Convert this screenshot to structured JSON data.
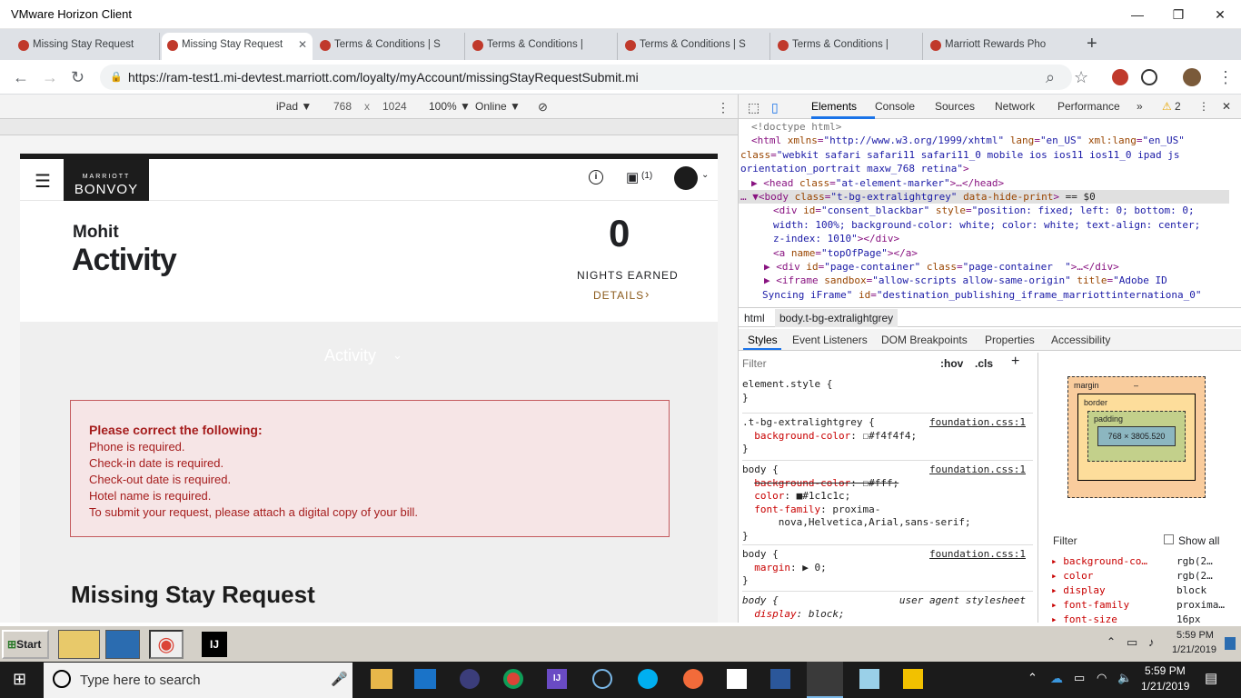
{
  "window": {
    "title": "VMware Horizon Client",
    "controls": [
      "—",
      "❐",
      "✕"
    ]
  },
  "browser": {
    "tabs": [
      {
        "label": "Missing Stay Request",
        "active": false
      },
      {
        "label": "Missing Stay Request",
        "active": true
      },
      {
        "label": "Terms & Conditions | S",
        "active": false
      },
      {
        "label": "Terms & Conditions |",
        "active": false
      },
      {
        "label": "Terms & Conditions | S",
        "active": false
      },
      {
        "label": "Terms & Conditions |",
        "active": false
      },
      {
        "label": "Marriott Rewards Pho",
        "active": false
      }
    ],
    "url": "https://ram-test1.mi-devtest.marriott.com/loyalty/myAccount/missingStayRequestSubmit.mi"
  },
  "device_toolbar": {
    "device": "iPad ▼",
    "width": "768",
    "x": "x",
    "height": "1024",
    "zoom": "100% ▼",
    "network": "Online ▼"
  },
  "site": {
    "logo_top": "MARRIOTT",
    "logo_bottom": "BONVOY",
    "points_badge": "(1)",
    "user_name": "Mohit",
    "heading": "Activity",
    "nights_value": "0",
    "nights_label": "NIGHTS EARNED",
    "details_link": "DETAILS",
    "activity_dropdown": "Activity",
    "errors": {
      "title": "Please correct the following:",
      "items": [
        "Phone is required.",
        "Check-in date is required.",
        "Check-out date is required.",
        "Hotel name is required.",
        "To submit your request, please attach a digital copy of your bill."
      ]
    },
    "form_title": "Missing Stay Request"
  },
  "devtools": {
    "tabs": [
      "Elements",
      "Console",
      "Sources",
      "Network",
      "Performance"
    ],
    "warnings": "2",
    "breadcrumbs": [
      "html",
      "body.t-bg-extralightgrey"
    ],
    "sub_tabs": [
      "Styles",
      "Event Listeners",
      "DOM Breakpoints",
      "Properties",
      "Accessibility"
    ],
    "filter_placeholder": "Filter",
    "hov": ":hov",
    "cls": ".cls",
    "box_model": {
      "margin": "margin",
      "border": "border",
      "padding": "padding",
      "content": "768 × 3805.520",
      "dash": "–"
    },
    "computed_filter": "Filter",
    "show_all": "Show all",
    "computed": [
      {
        "prop": "background-co…",
        "val": "rgb(2…"
      },
      {
        "prop": "color",
        "val": "rgb(2…"
      },
      {
        "prop": "display",
        "val": "block"
      },
      {
        "prop": "font-family",
        "val": "proxima…"
      },
      {
        "prop": "font-size",
        "val": "16px"
      }
    ]
  },
  "vmware_taskbar": {
    "start": "Start",
    "time": "5:59 PM",
    "date": "1/21/2019"
  },
  "windows_taskbar": {
    "search_placeholder": "Type here to search",
    "time": "5:59 PM",
    "date": "1/21/2019"
  }
}
